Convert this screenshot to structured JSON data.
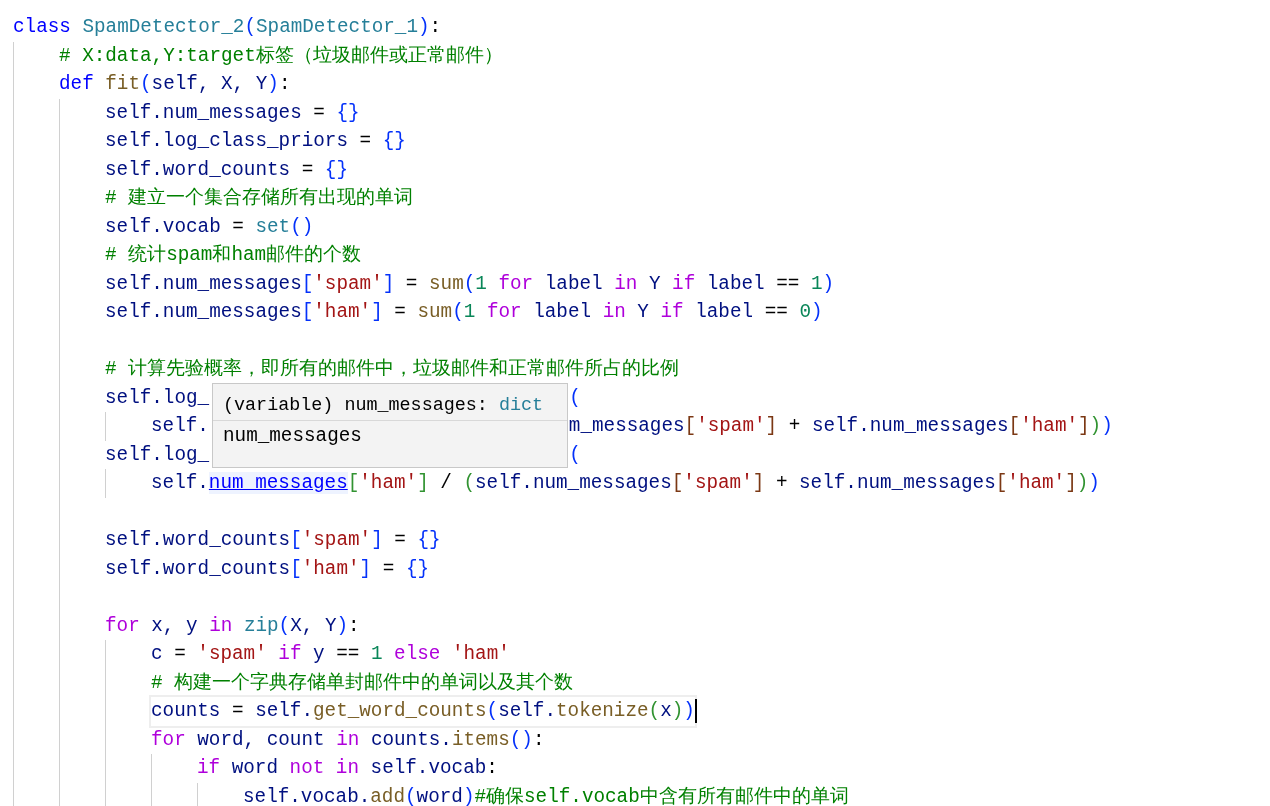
{
  "editor": {
    "lines": [
      {
        "tokens": [
          {
            "kind": "kw",
            "text": "class "
          },
          {
            "kind": "cls",
            "text": "SpamDetector_2"
          },
          {
            "kind": "b1",
            "text": "("
          },
          {
            "kind": "cls",
            "text": "SpamDetector_1"
          },
          {
            "kind": "b1",
            "text": ")"
          },
          {
            "kind": "op",
            "text": ":"
          }
        ],
        "children": [
          {
            "tokens": [
              {
                "kind": "cmt",
                "text": "# X:data,Y:target标签（垃圾邮件或正常邮件）"
              }
            ]
          },
          {
            "tokens": [
              {
                "kind": "kw",
                "text": "def "
              },
              {
                "kind": "fn",
                "text": "fit"
              },
              {
                "kind": "b1",
                "text": "("
              },
              {
                "kind": "id",
                "text": "self, X, Y"
              },
              {
                "kind": "b1",
                "text": ")"
              },
              {
                "kind": "op",
                "text": ":"
              }
            ],
            "children": [
              {
                "tokens": [
                  {
                    "kind": "id",
                    "text": "self.num_messages"
                  },
                  {
                    "kind": "op",
                    "text": " = "
                  },
                  {
                    "kind": "b1",
                    "text": "{}"
                  }
                ]
              },
              {
                "tokens": [
                  {
                    "kind": "id",
                    "text": "self.log_class_priors"
                  },
                  {
                    "kind": "op",
                    "text": " = "
                  },
                  {
                    "kind": "b1",
                    "text": "{}"
                  }
                ]
              },
              {
                "tokens": [
                  {
                    "kind": "id",
                    "text": "self.word_counts"
                  },
                  {
                    "kind": "op",
                    "text": " = "
                  },
                  {
                    "kind": "b1",
                    "text": "{}"
                  }
                ]
              },
              {
                "tokens": [
                  {
                    "kind": "cmt",
                    "text": "# 建立一个集合存储所有出现的单词"
                  }
                ]
              },
              {
                "tokens": [
                  {
                    "kind": "id",
                    "text": "self.vocab"
                  },
                  {
                    "kind": "op",
                    "text": " = "
                  },
                  {
                    "kind": "cls",
                    "text": "set"
                  },
                  {
                    "kind": "b1",
                    "text": "()"
                  }
                ]
              },
              {
                "tokens": [
                  {
                    "kind": "cmt",
                    "text": "# 统计spam和ham邮件的个数"
                  }
                ]
              },
              {
                "tokens": [
                  {
                    "kind": "id",
                    "text": "self.num_messages"
                  },
                  {
                    "kind": "b1",
                    "text": "["
                  },
                  {
                    "kind": "str",
                    "text": "'spam'"
                  },
                  {
                    "kind": "b1",
                    "text": "]"
                  },
                  {
                    "kind": "op",
                    "text": " = "
                  },
                  {
                    "kind": "fn",
                    "text": "sum"
                  },
                  {
                    "kind": "b1",
                    "text": "("
                  },
                  {
                    "kind": "num",
                    "text": "1 "
                  },
                  {
                    "kind": "ctl",
                    "text": "for "
                  },
                  {
                    "kind": "id",
                    "text": "label "
                  },
                  {
                    "kind": "ctl",
                    "text": "in "
                  },
                  {
                    "kind": "id",
                    "text": "Y "
                  },
                  {
                    "kind": "ctl",
                    "text": "if "
                  },
                  {
                    "kind": "id",
                    "text": "label "
                  },
                  {
                    "kind": "op",
                    "text": "== "
                  },
                  {
                    "kind": "num",
                    "text": "1"
                  },
                  {
                    "kind": "b1",
                    "text": ")"
                  }
                ]
              },
              {
                "tokens": [
                  {
                    "kind": "id",
                    "text": "self.num_messages"
                  },
                  {
                    "kind": "b1",
                    "text": "["
                  },
                  {
                    "kind": "str",
                    "text": "'ham'"
                  },
                  {
                    "kind": "b1",
                    "text": "]"
                  },
                  {
                    "kind": "op",
                    "text": " = "
                  },
                  {
                    "kind": "fn",
                    "text": "sum"
                  },
                  {
                    "kind": "b1",
                    "text": "("
                  },
                  {
                    "kind": "num",
                    "text": "1 "
                  },
                  {
                    "kind": "ctl",
                    "text": "for "
                  },
                  {
                    "kind": "id",
                    "text": "label "
                  },
                  {
                    "kind": "ctl",
                    "text": "in "
                  },
                  {
                    "kind": "id",
                    "text": "Y "
                  },
                  {
                    "kind": "ctl",
                    "text": "if "
                  },
                  {
                    "kind": "id",
                    "text": "label "
                  },
                  {
                    "kind": "op",
                    "text": "== "
                  },
                  {
                    "kind": "num",
                    "text": "0"
                  },
                  {
                    "kind": "b1",
                    "text": ")"
                  }
                ]
              },
              {
                "gap_before": true,
                "tokens": [
                  {
                    "kind": "cmt",
                    "text": "# 计算先验概率，即所有的邮件中，垃圾邮件和正常邮件所占的比例"
                  }
                ]
              },
              {
                "segments": [
                  [
                    {
                      "kind": "id",
                      "text": "self.log_"
                    }
                  ],
                  [
                    {
                      "kind": "b1",
                      "text": "("
                    }
                  ]
                ],
                "children": [
                  {
                    "segments": [
                      [
                        {
                          "kind": "id",
                          "text": "self."
                        }
                      ],
                      [
                        {
                          "kind": "id",
                          "text": "m_messages"
                        },
                        {
                          "kind": "b3",
                          "text": "["
                        },
                        {
                          "kind": "str",
                          "text": "'spam'"
                        },
                        {
                          "kind": "b3",
                          "text": "]"
                        },
                        {
                          "kind": "op",
                          "text": " + "
                        },
                        {
                          "kind": "id",
                          "text": "self.num_messages"
                        },
                        {
                          "kind": "b3",
                          "text": "["
                        },
                        {
                          "kind": "str",
                          "text": "'ham'"
                        },
                        {
                          "kind": "b3",
                          "text": "]"
                        },
                        {
                          "kind": "b2",
                          "text": ")"
                        },
                        {
                          "kind": "b1",
                          "text": ")"
                        }
                      ]
                    ]
                  }
                ]
              },
              {
                "segments": [
                  [
                    {
                      "kind": "id",
                      "text": "self.log_"
                    }
                  ],
                  [
                    {
                      "kind": "b1",
                      "text": "("
                    }
                  ]
                ],
                "children": [
                  {
                    "tokens": [
                      {
                        "kind": "id",
                        "text": "self."
                      },
                      {
                        "kind": "hover",
                        "text": "num_messages"
                      },
                      {
                        "kind": "b2",
                        "text": "["
                      },
                      {
                        "kind": "str",
                        "text": "'ham'"
                      },
                      {
                        "kind": "b2",
                        "text": "]"
                      },
                      {
                        "kind": "op",
                        "text": " / "
                      },
                      {
                        "kind": "b2",
                        "text": "("
                      },
                      {
                        "kind": "id",
                        "text": "self.num_messages"
                      },
                      {
                        "kind": "b3",
                        "text": "["
                      },
                      {
                        "kind": "str",
                        "text": "'spam'"
                      },
                      {
                        "kind": "b3",
                        "text": "]"
                      },
                      {
                        "kind": "op",
                        "text": " + "
                      },
                      {
                        "kind": "id",
                        "text": "self.num_messages"
                      },
                      {
                        "kind": "b3",
                        "text": "["
                      },
                      {
                        "kind": "str",
                        "text": "'ham'"
                      },
                      {
                        "kind": "b3",
                        "text": "]"
                      },
                      {
                        "kind": "b2",
                        "text": ")"
                      },
                      {
                        "kind": "b1",
                        "text": ")"
                      }
                    ]
                  }
                ]
              },
              {
                "gap_before": true,
                "tokens": [
                  {
                    "kind": "id",
                    "text": "self.word_counts"
                  },
                  {
                    "kind": "b1",
                    "text": "["
                  },
                  {
                    "kind": "str",
                    "text": "'spam'"
                  },
                  {
                    "kind": "b1",
                    "text": "]"
                  },
                  {
                    "kind": "op",
                    "text": " = "
                  },
                  {
                    "kind": "b1",
                    "text": "{}"
                  }
                ]
              },
              {
                "tokens": [
                  {
                    "kind": "id",
                    "text": "self.word_counts"
                  },
                  {
                    "kind": "b1",
                    "text": "["
                  },
                  {
                    "kind": "str",
                    "text": "'ham'"
                  },
                  {
                    "kind": "b1",
                    "text": "]"
                  },
                  {
                    "kind": "op",
                    "text": " = "
                  },
                  {
                    "kind": "b1",
                    "text": "{}"
                  }
                ]
              },
              {
                "gap_before": true,
                "tokens": [
                  {
                    "kind": "ctl",
                    "text": "for "
                  },
                  {
                    "kind": "id",
                    "text": "x, y "
                  },
                  {
                    "kind": "ctl",
                    "text": "in "
                  },
                  {
                    "kind": "cls",
                    "text": "zip"
                  },
                  {
                    "kind": "b1",
                    "text": "("
                  },
                  {
                    "kind": "id",
                    "text": "X, Y"
                  },
                  {
                    "kind": "b1",
                    "text": ")"
                  },
                  {
                    "kind": "op",
                    "text": ":"
                  }
                ],
                "children": [
                  {
                    "tokens": [
                      {
                        "kind": "id",
                        "text": "c "
                      },
                      {
                        "kind": "op",
                        "text": "= "
                      },
                      {
                        "kind": "str",
                        "text": "'spam' "
                      },
                      {
                        "kind": "ctl",
                        "text": "if "
                      },
                      {
                        "kind": "id",
                        "text": "y "
                      },
                      {
                        "kind": "op",
                        "text": "== "
                      },
                      {
                        "kind": "num",
                        "text": "1 "
                      },
                      {
                        "kind": "ctl",
                        "text": "else "
                      },
                      {
                        "kind": "str",
                        "text": "'ham'"
                      }
                    ]
                  },
                  {
                    "tokens": [
                      {
                        "kind": "cmt",
                        "text": "# 构建一个字典存储单封邮件中的单词以及其个数"
                      }
                    ]
                  },
                  {
                    "current": true,
                    "tokens": [
                      {
                        "kind": "id",
                        "text": "counts "
                      },
                      {
                        "kind": "op",
                        "text": "= "
                      },
                      {
                        "kind": "id",
                        "text": "self."
                      },
                      {
                        "kind": "fn",
                        "text": "get_word_counts"
                      },
                      {
                        "kind": "b1",
                        "text": "("
                      },
                      {
                        "kind": "id",
                        "text": "self."
                      },
                      {
                        "kind": "fn",
                        "text": "tokenize"
                      },
                      {
                        "kind": "b2",
                        "text": "("
                      },
                      {
                        "kind": "id",
                        "text": "x"
                      },
                      {
                        "kind": "b2",
                        "text": ")"
                      },
                      {
                        "kind": "b1",
                        "text": ")"
                      }
                    ]
                  },
                  {
                    "tokens": [
                      {
                        "kind": "ctl",
                        "text": "for "
                      },
                      {
                        "kind": "id",
                        "text": "word, count "
                      },
                      {
                        "kind": "ctl",
                        "text": "in "
                      },
                      {
                        "kind": "id",
                        "text": "counts."
                      },
                      {
                        "kind": "fn",
                        "text": "items"
                      },
                      {
                        "kind": "b1",
                        "text": "()"
                      },
                      {
                        "kind": "op",
                        "text": ":"
                      }
                    ],
                    "children": [
                      {
                        "tokens": [
                          {
                            "kind": "ctl",
                            "text": "if "
                          },
                          {
                            "kind": "id",
                            "text": "word "
                          },
                          {
                            "kind": "ctl",
                            "text": "not in "
                          },
                          {
                            "kind": "id",
                            "text": "self.vocab"
                          },
                          {
                            "kind": "op",
                            "text": ":"
                          }
                        ],
                        "children": [
                          {
                            "tokens": [
                              {
                                "kind": "id",
                                "text": "self.vocab."
                              },
                              {
                                "kind": "fn",
                                "text": "add"
                              },
                              {
                                "kind": "b1",
                                "text": "("
                              },
                              {
                                "kind": "id",
                                "text": "word"
                              },
                              {
                                "kind": "b1",
                                "text": ")"
                              },
                              {
                                "kind": "cmt",
                                "text": "#确保self.vocab中含有所有邮件中的单词"
                              }
                            ]
                          }
                        ]
                      }
                    ]
                  }
                ]
              }
            ]
          }
        ]
      }
    ],
    "hover_tooltip": {
      "signature": "(variable) num_messages: ",
      "type": "dict",
      "doc": "num_messages"
    }
  }
}
